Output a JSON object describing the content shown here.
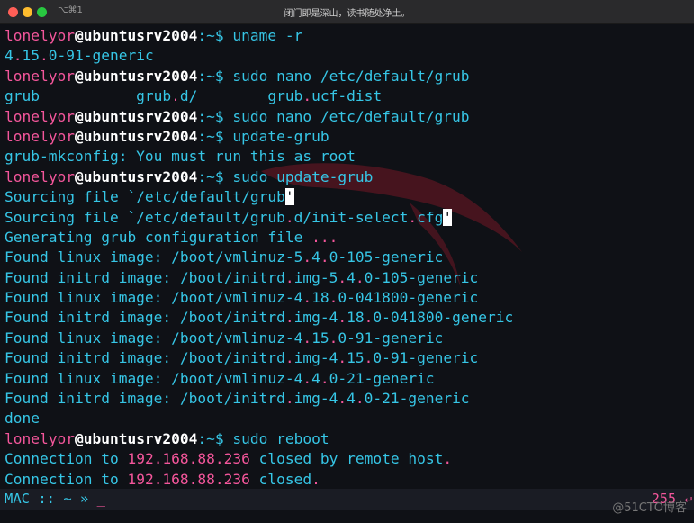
{
  "titlebar": {
    "shortcut": "⌥⌘1",
    "title": "闭门即是深山，读书随处净土。"
  },
  "terminal_lines": [
    [
      "lonelyor@ubuntusrv2004:~$ uname -r"
    ],
    [
      "4.15.0-91-generic"
    ],
    [
      "lonelyor@ubuntusrv2004:~$ sudo nano /etc/default/grub"
    ],
    [
      "grub           grub.d/        grub.ucf-dist"
    ],
    [
      "lonelyor@ubuntusrv2004:~$ sudo nano /etc/default/grub"
    ],
    [
      "lonelyor@ubuntusrv2004:~$ update-grub"
    ],
    [
      "grub-mkconfig: You must run this as root"
    ],
    [
      "lonelyor@ubuntusrv2004:~$ sudo update-grub"
    ],
    [
      "Sourcing file `/etc/default/grub'"
    ],
    [
      "Sourcing file `/etc/default/grub.d/init-select.cfg'"
    ],
    [
      "Generating grub configuration file ..."
    ],
    [
      "Found linux image: /boot/vmlinuz-5.4.0-105-generic"
    ],
    [
      "Found initrd image: /boot/initrd.img-5.4.0-105-generic"
    ],
    [
      "Found linux image: /boot/vmlinuz-4.18.0-041800-generic"
    ],
    [
      "Found initrd image: /boot/initrd.img-4.18.0-041800-generic"
    ],
    [
      "Found linux image: /boot/vmlinuz-4.15.0-91-generic"
    ],
    [
      "Found initrd image: /boot/initrd.img-4.15.0-91-generic"
    ],
    [
      "Found linux image: /boot/vmlinuz-4.4.0-21-generic"
    ],
    [
      "Found initrd image: /boot/initrd.img-4.4.0-21-generic"
    ],
    [
      "done"
    ],
    [
      "lonelyor@ubuntusrv2004:~$ sudo reboot"
    ],
    [
      "Connection to 192.168.88.236 closed by remote host."
    ],
    [
      "Connection to 192.168.88.236 closed."
    ]
  ],
  "statusbar": {
    "prompt": "MAC :: ~ » ",
    "cursor": "_",
    "exit_code": "255",
    "return_symbol": "↵"
  },
  "watermark": "@51CTO博客",
  "colors": {
    "background": "#0f1116",
    "text": "#36c6e6",
    "user": "#f4569b",
    "host": "#ffffff",
    "accent": "#f4569b"
  }
}
